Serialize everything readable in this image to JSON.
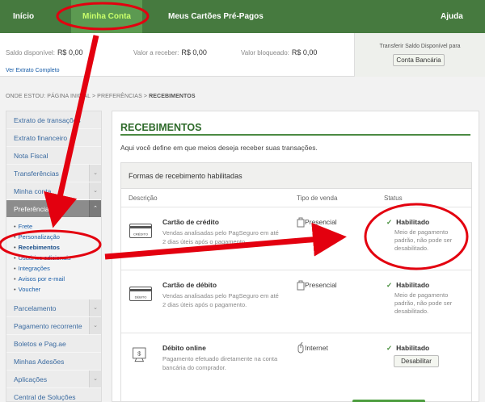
{
  "nav": {
    "inicio": "Início",
    "minha_conta": "Minha Conta",
    "cartoes": "Meus Cartões Pré-Pagos",
    "ajuda": "Ajuda"
  },
  "balance": {
    "disponivel_label": "Saldo disponível:",
    "disponivel_value": "R$ 0,00",
    "receber_label": "Valor a receber:",
    "receber_value": "R$ 0,00",
    "bloqueado_label": "Valor bloqueado:",
    "bloqueado_value": "R$ 0,00",
    "extrato_link": "Ver Extrato Completo",
    "transfer_label": "Transferir Saldo Disponível para",
    "transfer_button": "Conta Bancária"
  },
  "breadcrumb": {
    "prefix": "ONDE ESTOU: PÁGINA INICIAL > PREFERÊNCIAS >",
    "current": "RECEBIMENTOS"
  },
  "sidebar": {
    "items": [
      {
        "label": "Extrato de transações"
      },
      {
        "label": "Extrato financeiro"
      },
      {
        "label": "Nota Fiscal"
      },
      {
        "label": "Transferências"
      },
      {
        "label": "Minha conta"
      },
      {
        "label": "Preferências"
      },
      {
        "label": "Parcelamento"
      },
      {
        "label": "Pagamento recorrente"
      },
      {
        "label": "Boletos e Pag.ae"
      },
      {
        "label": "Minhas Adesões"
      },
      {
        "label": "Aplicações"
      },
      {
        "label": "Central de Soluções"
      }
    ],
    "subitems": [
      "Frete",
      "Personalização",
      "Recebimentos",
      "Usuários adicionais",
      "Integrações",
      "Avisos por e-mail",
      "Voucher"
    ]
  },
  "main": {
    "title": "RECEBIMENTOS",
    "intro": "Aqui você define em que meios deseja receber suas transações.",
    "table_title": "Formas de recebimento habilitadas",
    "col_descricao": "Descrição",
    "col_tipo": "Tipo de venda",
    "col_status": "Status",
    "rows": [
      {
        "icon": "credit-card-icon",
        "icon_label": "CRÉDITO",
        "title": "Cartão de crédito",
        "desc": "Vendas analisadas pelo PagSeguro em até 2 dias úteis após o pagamento",
        "tipo": "Presencial",
        "status": "Habilitado",
        "status_desc": "Meio de pagamento padrão, não pode ser desabilitado."
      },
      {
        "icon": "debit-card-icon",
        "icon_label": "DÉBITO",
        "title": "Cartão de débito",
        "desc": "Vendas analisadas pelo PagSeguro em até 2 dias úteis após o pagamento.",
        "tipo": "Presencial",
        "status": "Habilitado",
        "status_desc": "Meio de pagamento padrão, não pode ser desabilitado."
      },
      {
        "icon": "online-debit-icon",
        "title": "Débito online",
        "desc": "Pagamento efetuado diretamente na conta bancária do comprador.",
        "tipo": "Internet",
        "status": "Habilitado",
        "button": "Desabilitar"
      }
    ]
  },
  "colors": {
    "nav_bg": "#467a3f",
    "accent_green": "#2e6a2a",
    "annotation_red": "#e3000f"
  }
}
